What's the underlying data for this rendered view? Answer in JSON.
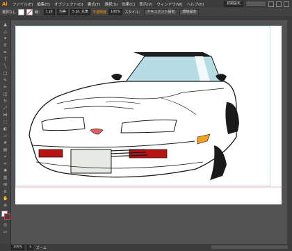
{
  "app": {
    "logo_text": "Ai"
  },
  "menu": {
    "items": [
      "ファイル(F)",
      "編集(E)",
      "オブジェクト(O)",
      "書式(T)",
      "選択(S)",
      "効果(C)",
      "表示(V)",
      "ウィンドウ(W)",
      "ヘルプ(H)"
    ],
    "workspace": "初期設定"
  },
  "control": {
    "selection_label": "選択なし",
    "stroke_label": "線：",
    "stroke_value": "1 pt",
    "stroke_style": "均等",
    "brush_value": "5 pt. 丸筆",
    "opacity_label": "不透明度",
    "opacity_value": "100%",
    "style_label": "スタイル：",
    "doc_setup": "ドキュメント設定",
    "prefs": "環境設定"
  },
  "status": {
    "zoom": "100%",
    "page": "1",
    "tool": "ズーム"
  },
  "colors": {
    "accent": "#ff9a00",
    "ui_dark": "#3c3c3c",
    "artboard": "#ffffff",
    "windshield": "#b7dce3",
    "plate": "#e7e9e5",
    "taillight": "#b81212"
  }
}
